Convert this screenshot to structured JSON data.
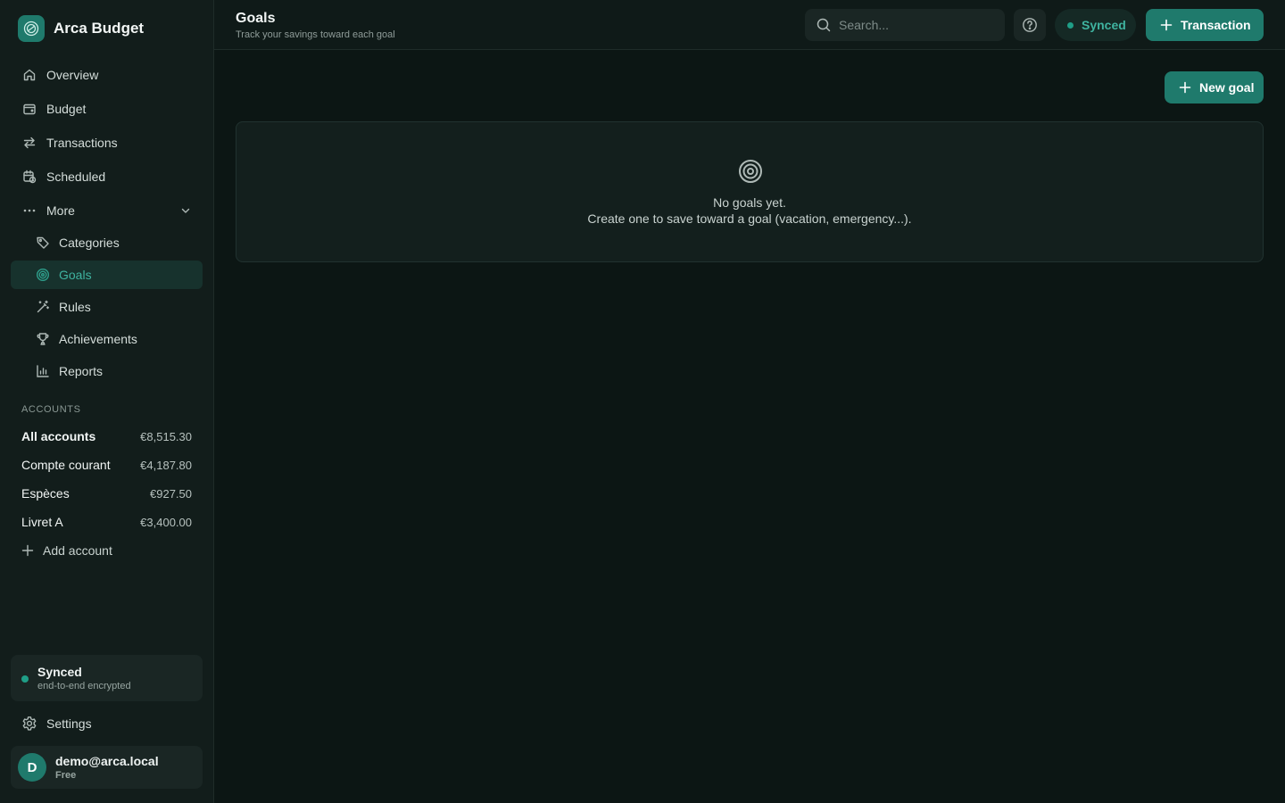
{
  "app": {
    "name": "Arca Budget"
  },
  "nav": {
    "overview": "Overview",
    "budget": "Budget",
    "transactions": "Transactions",
    "scheduled": "Scheduled",
    "more": "More",
    "categories": "Categories",
    "goals": "Goals",
    "rules": "Rules",
    "achievements": "Achievements",
    "reports": "Reports"
  },
  "accounts": {
    "section_label": "ACCOUNTS",
    "items": [
      {
        "name": "All accounts",
        "amount": "€8,515.30"
      },
      {
        "name": "Compte courant",
        "amount": "€4,187.80"
      },
      {
        "name": "Espèces",
        "amount": "€927.50"
      },
      {
        "name": "Livret A",
        "amount": "€3,400.00"
      }
    ],
    "add_label": "Add account"
  },
  "sync_card": {
    "title": "Synced",
    "subtitle": "end-to-end encrypted"
  },
  "settings": {
    "label": "Settings"
  },
  "user": {
    "initial": "D",
    "email": "demo@arca.local",
    "plan": "Free"
  },
  "header": {
    "title": "Goals",
    "subtitle": "Track your savings toward each goal",
    "search_placeholder": "Search...",
    "synced_label": "Synced",
    "transaction_button": "Transaction"
  },
  "goals": {
    "new_goal_button": "New goal",
    "empty_title": "No goals yet.",
    "empty_message": "Create one to save toward a goal (vacation, emergency...)."
  },
  "colors": {
    "accent": "#1f7a6c",
    "accent_text": "#3fb3a0",
    "background": "#0c1614",
    "sidebar": "#121d1b"
  }
}
